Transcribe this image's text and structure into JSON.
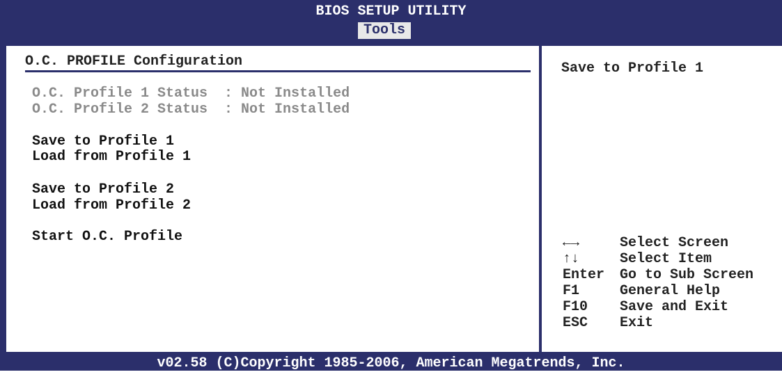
{
  "header": {
    "title": "BIOS SETUP UTILITY",
    "active_tab": "Tools"
  },
  "section": {
    "title": "O.C. PROFILE Configuration"
  },
  "status": [
    {
      "label": "O.C. Profile 1 Status",
      "value": "Not Installed"
    },
    {
      "label": "O.C. Profile 2 Status",
      "value": "Not Installed"
    }
  ],
  "status_text": [
    "O.C. Profile 1 Status  : Not Installed",
    "O.C. Profile 2 Status  : Not Installed"
  ],
  "menu": [
    {
      "label": "Save to Profile 1"
    },
    {
      "label": "Load from Profile 1"
    },
    {
      "label": "Save to Profile 2"
    },
    {
      "label": "Load from Profile 2"
    },
    {
      "label": "Start O.C. Profile"
    }
  ],
  "help": {
    "text": "Save to Profile 1"
  },
  "keys": [
    {
      "key": "←→",
      "desc": "Select Screen"
    },
    {
      "key": "↑↓",
      "desc": "Select Item"
    },
    {
      "key": "Enter",
      "desc": "Go to Sub Screen"
    },
    {
      "key": "F1",
      "desc": "General Help"
    },
    {
      "key": "F10",
      "desc": "Save and Exit"
    },
    {
      "key": "ESC",
      "desc": "Exit"
    }
  ],
  "footer": {
    "text": "v02.58 (C)Copyright 1985-2006, American Megatrends, Inc."
  },
  "colors": {
    "frame": "#2b2f6b",
    "panel": "#ffffff",
    "disabled_text": "#8a8a8a",
    "tab_highlight": "#e8e8e8"
  }
}
